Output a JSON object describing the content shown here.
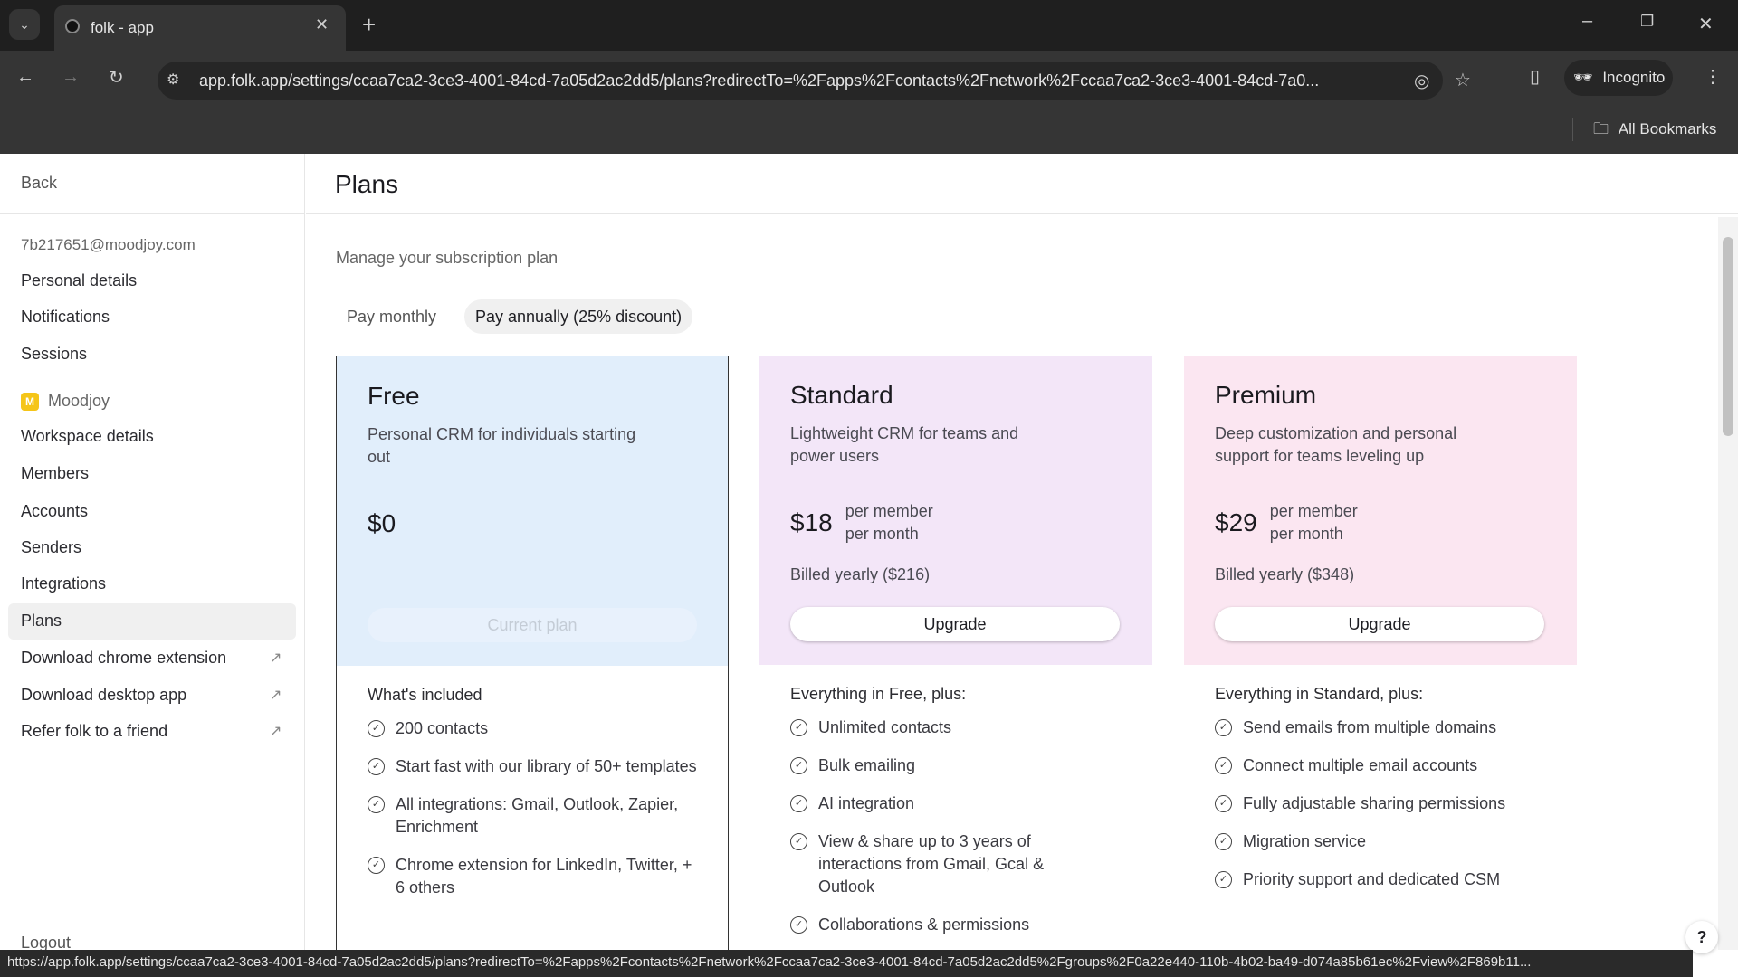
{
  "browser": {
    "tab_title": "folk - app",
    "url": "app.folk.app/settings/ccaa7ca2-3ce3-4001-84cd-7a05d2ac2dd5/plans?redirectTo=%2Fapps%2Fcontacts%2Fnetwork%2Fccaa7ca2-3ce3-4001-84cd-7a0...",
    "incognito_label": "Incognito",
    "bookmarks_label": "All Bookmarks",
    "status_url": "https://app.folk.app/settings/ccaa7ca2-3ce3-4001-84cd-7a05d2ac2dd5/plans?redirectTo=%2Fapps%2Fcontacts%2Fnetwork%2Fccaa7ca2-3ce3-4001-84cd-7a05d2ac2dd5%2Fgroups%2F0a22e440-110b-4b02-ba49-d074a85b61ec%2Fview%2F869b11..."
  },
  "sidebar": {
    "back": "Back",
    "email": "7b217651@moodjoy.com",
    "personal": [
      "Personal details",
      "Notifications",
      "Sessions"
    ],
    "workspace_initial": "M",
    "workspace_name": "Moodjoy",
    "workspace_items": [
      "Workspace details",
      "Members",
      "Accounts",
      "Senders",
      "Integrations",
      "Plans"
    ],
    "external": [
      "Download chrome extension",
      "Download desktop app",
      "Refer folk to a friend"
    ],
    "logout": "Logout",
    "workspace_color": "#f5c518"
  },
  "main": {
    "title": "Plans",
    "subtitle": "Manage your subscription plan",
    "toggle": {
      "monthly": "Pay monthly",
      "annually": "Pay annually (25% discount)",
      "selected": "annually"
    },
    "help": "?"
  },
  "plans": [
    {
      "name": "Free",
      "desc": "Personal CRM for individuals starting out",
      "price": "$0",
      "per": "",
      "per2": "",
      "billed": "",
      "button": "Current plan",
      "color": "#e1eefb",
      "features_title": "What's included",
      "features": [
        "200 contacts",
        "Start fast with our library of 50+ templates",
        "All integrations: Gmail, Outlook, Zapier, Enrichment",
        "Chrome extension for LinkedIn, Twitter, + 6 others"
      ]
    },
    {
      "name": "Standard",
      "desc": "Lightweight CRM for teams and power users",
      "price": "$18",
      "per": "per member",
      "per2": "per month",
      "billed": "Billed yearly ($216)",
      "button": "Upgrade",
      "color": "#f3e6f8",
      "features_title": "Everything in Free, plus:",
      "features": [
        "Unlimited contacts",
        "Bulk emailing",
        "AI integration",
        "View & share up to 3 years of interactions from Gmail, Gcal & Outlook",
        "Collaborations & permissions"
      ]
    },
    {
      "name": "Premium",
      "desc": "Deep customization and personal support for teams leveling up",
      "price": "$29",
      "per": "per member",
      "per2": "per month",
      "billed": "Billed yearly ($348)",
      "button": "Upgrade",
      "color": "#fbe6f1",
      "features_title": "Everything in Standard, plus:",
      "features": [
        "Send emails from multiple domains",
        "Connect multiple email accounts",
        "Fully adjustable sharing permissions",
        "Migration service",
        "Priority support and dedicated CSM"
      ]
    }
  ]
}
